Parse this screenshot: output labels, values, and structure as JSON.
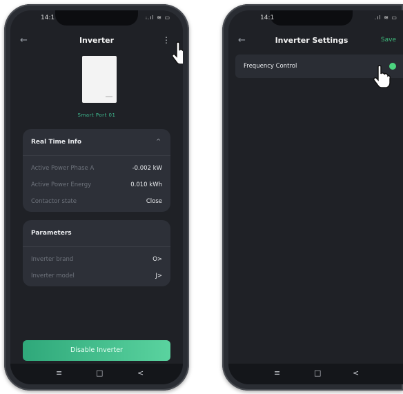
{
  "left": {
    "status_time": "14:1",
    "status_icons": "ᵢ.ıl ≋ ▭",
    "title": "Inverter",
    "back_icon": "←",
    "menu_icon": "⋮",
    "device_name": "Smart Port 01",
    "realtime": {
      "title": "Real Time Info",
      "caret": "^",
      "rows": [
        {
          "label": "Active Power Phase A",
          "value": "-0.002 kW"
        },
        {
          "label": "Active Power Energy",
          "value": "0.010 kWh"
        },
        {
          "label": "Contactor state",
          "value": "Close"
        }
      ]
    },
    "parameters": {
      "title": "Parameters",
      "rows": [
        {
          "label": "Inverter brand",
          "value": "O>"
        },
        {
          "label": "Inverter model",
          "value": "J>"
        }
      ]
    },
    "cta": "Disable Inverter",
    "nav": {
      "menu": "≡",
      "home": "□",
      "back": "<"
    }
  },
  "right": {
    "status_time": "14:1",
    "status_icons": ".ıl ≋ ▭",
    "back_icon": "←",
    "title": "Inverter Settings",
    "save": "Save",
    "frequency_control": {
      "label": "Frequency Control",
      "enabled": true,
      "accent": "#4cd47f"
    },
    "nav": {
      "menu": "≡",
      "home": "□",
      "back": "<"
    }
  }
}
